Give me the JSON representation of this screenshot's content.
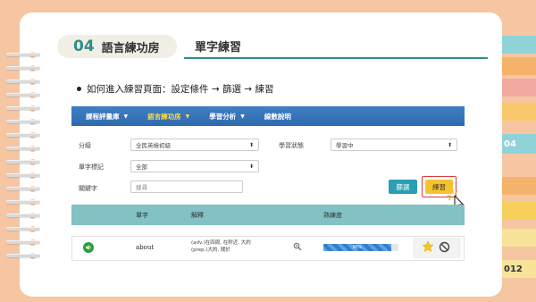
{
  "side_tabs": {
    "chapter_num": "04",
    "page_num": "012",
    "colors": [
      "#8fd3d9",
      "#f5b26b",
      "#f7cf5a",
      "#f2a9a0",
      "#f9c86a",
      "#8fd3d9",
      "#f5b26b",
      "#f7cf5a",
      "#f7e39a"
    ]
  },
  "header": {
    "chapter_number": "04",
    "chapter_title": "語言練功房",
    "section_title": "單字練習"
  },
  "instruction": "如何進入練習頁面：設定條件 → 篩選 → 練習",
  "nav": {
    "items": [
      {
        "label": "課程評量庫",
        "caret": "▼"
      },
      {
        "label": "語言練功房",
        "caret": "▼"
      },
      {
        "label": "學習分析",
        "caret": "▼"
      },
      {
        "label": "線數說明",
        "caret": ""
      }
    ]
  },
  "filters": {
    "level_label": "分級",
    "level_value": "全民英檢初級",
    "status_label": "學習狀態",
    "status_value": "學習中",
    "mark_label": "單字標記",
    "mark_value": "全部",
    "keyword_label": "關鍵字",
    "keyword_placeholder": "搜尋",
    "filter_button": "篩選",
    "practice_button": "練習"
  },
  "table": {
    "columns": [
      "單字",
      "解釋",
      "熟練度"
    ],
    "rows": [
      {
        "word": "about",
        "explanation_line1": "(adv.)在四周, 在附近, 大約",
        "explanation_line2": "(prep.)大約, 關於",
        "proficiency_percent": 90,
        "proficiency_label": "90%"
      }
    ]
  },
  "colors": {
    "accent_teal": "#2f8e88",
    "nav_blue": "#2f6aae",
    "nav_active": "#ffd84a",
    "filter_button": "#2a9fb3",
    "practice_button": "#f4c430",
    "table_header": "#82c1c4"
  },
  "icons": {
    "speaker": "speaker-icon",
    "zoom": "magnifier-icon",
    "star": "star-icon",
    "block": "block-icon",
    "cursor": "pointer-cursor-icon"
  }
}
